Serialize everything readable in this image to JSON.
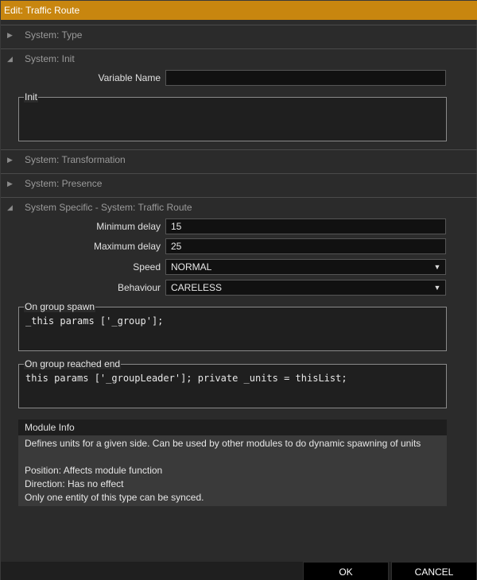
{
  "window": {
    "title": "Edit: Traffic Route"
  },
  "sections": {
    "type": {
      "label": "System: Type",
      "arrow": "▶"
    },
    "init": {
      "label": "System: Init",
      "arrow": "◢"
    },
    "transformation": {
      "label": "System: Transformation",
      "arrow": "▶"
    },
    "presence": {
      "label": "System: Presence",
      "arrow": "▶"
    },
    "specific": {
      "label": "System Specific - System: Traffic Route",
      "arrow": "◢"
    }
  },
  "init": {
    "variable_name_label": "Variable Name",
    "variable_name_value": "",
    "init_legend": "Init",
    "init_value": ""
  },
  "specific": {
    "min_delay_label": "Minimum delay",
    "min_delay_value": "15",
    "max_delay_label": "Maximum delay",
    "max_delay_value": "25",
    "speed_label": "Speed",
    "speed_value": "NORMAL",
    "behaviour_label": "Behaviour",
    "behaviour_value": "CARELESS",
    "dropdown_glyph": "▼",
    "on_spawn_legend": "On group spawn",
    "on_spawn_code": "_this params ['_group'];",
    "on_end_legend": "On group reached end",
    "on_end_code": "this params ['_groupLeader']; private _units = thisList;"
  },
  "module_info": {
    "title": "Module Info",
    "description": "Defines units for a given side. Can be used by other modules to do dynamic spawning of units",
    "position": "Position: Affects module function",
    "direction": "Direction: Has no effect",
    "sync": "Only one entity of this type can be synced."
  },
  "buttons": {
    "ok": "OK",
    "cancel": "CANCEL"
  },
  "colors": {
    "accent": "#c8860f",
    "background": "#2b2b2b",
    "field": "#111111"
  }
}
